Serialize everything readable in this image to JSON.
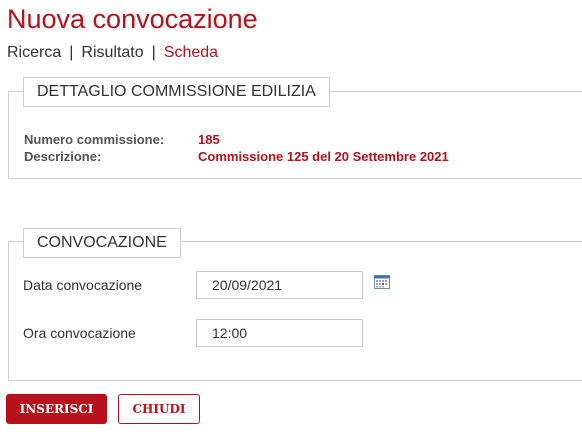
{
  "page": {
    "title": "Nuova convocazione"
  },
  "breadcrumb": {
    "items": [
      "Ricerca",
      "Risultato",
      "Scheda"
    ],
    "separator": "|"
  },
  "detail": {
    "legend": "DETTAGLIO COMMISSIONE EDILIZIA",
    "rows": [
      {
        "label": "Numero commissione:",
        "value": "185"
      },
      {
        "label": "Descrizione:",
        "value": "Commissione 125 del 20 Settembre 2021"
      }
    ]
  },
  "convocazione": {
    "legend": "CONVOCAZIONE",
    "date_label": "Data convocazione",
    "date_value": "20/09/2021",
    "time_label": "Ora convocazione",
    "time_value": "12:00",
    "calendar_icon": "calendar-icon"
  },
  "actions": {
    "insert_label": "INSERISCI",
    "close_label": "CHIUDI"
  },
  "colors": {
    "accent": "#b5121b",
    "border": "#cfcfcf",
    "text": "#333333"
  }
}
